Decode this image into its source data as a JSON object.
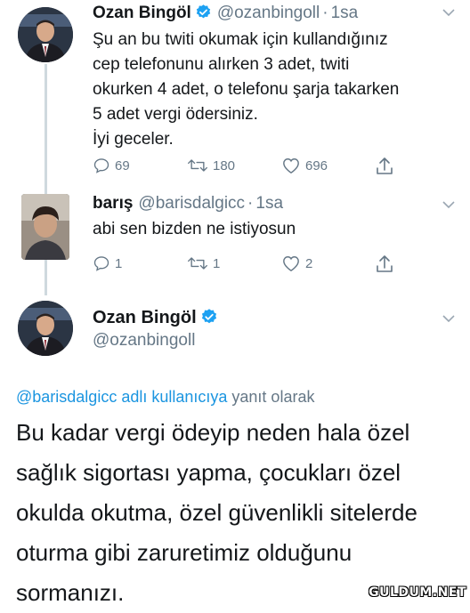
{
  "tweet1": {
    "name": "Ozan Bingöl",
    "handle": "@ozanbingoll",
    "time": "1sa",
    "text_lines": [
      "Şu an bu twiti okumak için kullandığınız",
      "cep telefonunu alırken 3 adet, twiti",
      "okurken 4 adet, o telefonu şarja takarken",
      "5 adet vergi ödersiniz.",
      "İyi geceler."
    ],
    "replies": "69",
    "retweets": "180",
    "likes": "696"
  },
  "tweet2": {
    "name": "barış",
    "handle": "@barisdalgicc",
    "time": "1sa",
    "text": "abi sen bizden ne istiyosun",
    "replies": "1",
    "retweets": "1",
    "likes": "2"
  },
  "tweet3": {
    "name": "Ozan Bingöl",
    "handle": "@ozanbingoll",
    "reply_to_mention": "@barisdalgicc adlı kullanıcıya",
    "reply_to_suffix": "yanıt olarak",
    "text_lines": [
      "Bu kadar vergi ödeyip neden hala özel",
      "sağlık sigortası yapma, çocukları özel",
      "okulda okutma, özel güvenlikli sitelerde",
      "oturma gibi zaruretimiz olduğunu",
      "sormanızı."
    ]
  },
  "watermark": "GULDUM.NET",
  "colors": {
    "accent": "#1da1f2",
    "muted": "#657786",
    "link": "#1b95e0"
  },
  "icons": [
    "verified-badge-icon",
    "chevron-down-icon",
    "reply-icon",
    "retweet-icon",
    "like-icon",
    "share-icon"
  ]
}
